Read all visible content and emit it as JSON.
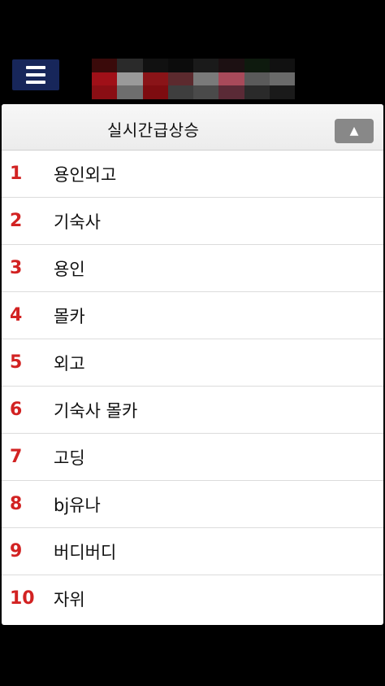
{
  "header": {
    "menu_icon": "hamburger-menu-icon",
    "menu_color": "#17265a"
  },
  "panel": {
    "title": "실시간급상승",
    "collapse_symbol": "▲",
    "rank_color": "#d22222"
  },
  "rankings": [
    {
      "rank": "1",
      "keyword": "용인외고"
    },
    {
      "rank": "2",
      "keyword": "기숙사"
    },
    {
      "rank": "3",
      "keyword": "용인"
    },
    {
      "rank": "4",
      "keyword": "몰카"
    },
    {
      "rank": "5",
      "keyword": "외고"
    },
    {
      "rank": "6",
      "keyword": "기숙사 몰카"
    },
    {
      "rank": "7",
      "keyword": "고딩"
    },
    {
      "rank": "8",
      "keyword": "bj유나"
    },
    {
      "rank": "9",
      "keyword": "버디버디"
    },
    {
      "rank": "10",
      "keyword": "자위"
    }
  ]
}
